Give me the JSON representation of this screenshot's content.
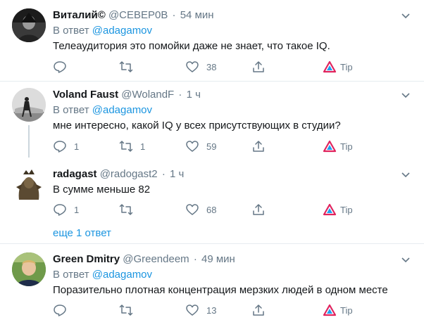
{
  "tweets": [
    {
      "name": "Виталий©",
      "handle": "@СЕВЕР0В",
      "dot": "·",
      "time": "54 мин",
      "reply_prefix": "В ответ",
      "reply_mention": "@adagamov",
      "text": "Телеаудитория это помойки даже не знает, что такое IQ.",
      "replies": "",
      "retweets": "",
      "likes": "38",
      "tip": "Tip"
    },
    {
      "name": "Voland Faust",
      "handle": "@WolandF",
      "dot": "·",
      "time": "1 ч",
      "reply_prefix": "В ответ",
      "reply_mention": "@adagamov",
      "text": "мне интересно, какой IQ у всех присутствующих в студии?",
      "replies": "1",
      "retweets": "1",
      "likes": "59",
      "tip": "Tip"
    },
    {
      "name": "radagast",
      "handle": "@radogast2",
      "dot": "·",
      "time": "1 ч",
      "reply_prefix": "",
      "reply_mention": "",
      "text": "В сумме меньше 82",
      "replies": "1",
      "retweets": "",
      "likes": "68",
      "tip": "Tip"
    },
    {
      "name": "Green Dmitry",
      "handle": "@Greendeem",
      "dot": "·",
      "time": "49 мин",
      "reply_prefix": "В ответ",
      "reply_mention": "@adagamov",
      "text": "Поразительно плотная  концентрация мерзких людей в одном месте",
      "replies": "",
      "retweets": "",
      "likes": "13",
      "tip": "Tip"
    }
  ],
  "show_more": "еще 1 ответ",
  "icons": {
    "reply": "reply-icon",
    "retweet": "retweet-icon",
    "like": "heart-icon",
    "share": "share-icon",
    "tip": "tip-icon",
    "caret": "chevron-down-icon"
  },
  "colors": {
    "accent": "#1b95e0",
    "muted": "#657786",
    "tip": "#e0245e",
    "separator": "#e6ecf0"
  }
}
